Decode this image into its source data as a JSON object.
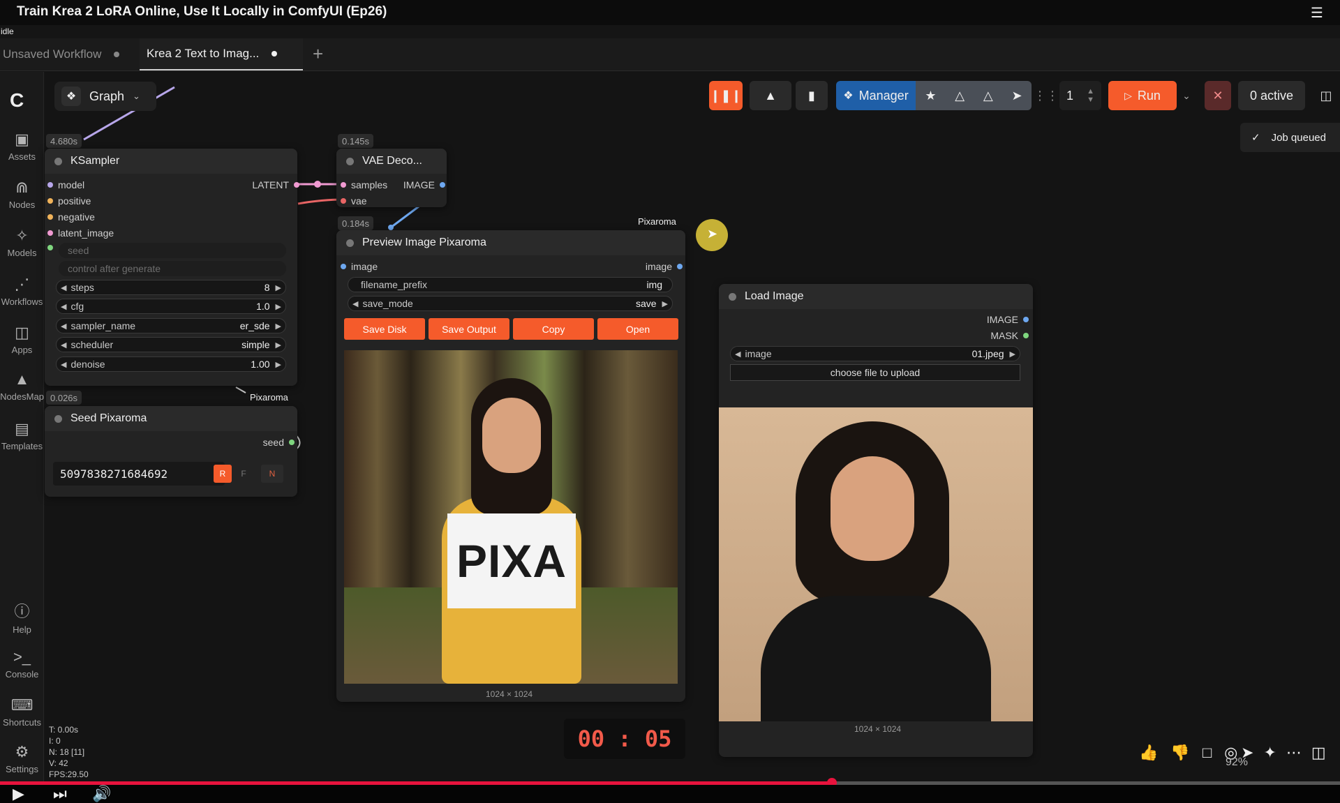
{
  "video": {
    "title": "Train Krea 2 LoRA Online, Use It Locally in ComfyUI (Ep26)"
  },
  "status": {
    "idle": "idle"
  },
  "tabs": [
    {
      "label": "Unsaved Workflow"
    },
    {
      "label": "Krea 2 Text to Imag..."
    }
  ],
  "sidebar": {
    "items": [
      {
        "label": "Assets",
        "icon": "image-icon"
      },
      {
        "label": "Nodes",
        "icon": "nodes-icon"
      },
      {
        "label": "Models",
        "icon": "models-icon"
      },
      {
        "label": "Workflows",
        "icon": "workflows-icon"
      },
      {
        "label": "Apps",
        "icon": "apps-icon"
      },
      {
        "label": "NodesMap",
        "icon": "nodesmap-icon"
      },
      {
        "label": "Templates",
        "icon": "templates-icon"
      },
      {
        "label": "Help",
        "icon": "help-icon"
      },
      {
        "label": "Console",
        "icon": "console-icon"
      },
      {
        "label": "Shortcuts",
        "icon": "keyboard-icon"
      },
      {
        "label": "Settings",
        "icon": "gear-icon"
      }
    ]
  },
  "graph_toggle": {
    "label": "Graph"
  },
  "toolbar": {
    "manager_label": "Manager",
    "queue_count": "1",
    "run_label": "Run",
    "active_label": "0 active"
  },
  "toast": {
    "text": "Job queued"
  },
  "stats": [
    "T: 0.00s",
    "I: 0",
    "N: 18 [11]",
    "V: 42",
    "FPS:29.50"
  ],
  "nodes": {
    "ksampler": {
      "title": "KSampler",
      "timing": "4.680s",
      "inputs": [
        "model",
        "positive",
        "negative",
        "latent_image"
      ],
      "output": "LATENT",
      "seed_label": "seed",
      "control_label": "control after generate",
      "widgets": [
        {
          "name": "steps",
          "value": "8"
        },
        {
          "name": "cfg",
          "value": "1.0"
        },
        {
          "name": "sampler_name",
          "value": "er_sde"
        },
        {
          "name": "scheduler",
          "value": "simple"
        },
        {
          "name": "denoise",
          "value": "1.00"
        }
      ]
    },
    "vae_decode": {
      "title": "VAE Deco...",
      "timing": "0.145s",
      "inputs": [
        "samples",
        "vae"
      ],
      "output": "IMAGE"
    },
    "preview": {
      "title": "Preview Image Pixaroma",
      "timing": "0.184s",
      "group_label": "Pixaroma",
      "input": "image",
      "output": "image",
      "widgets": [
        {
          "name": "filename_prefix",
          "value": "img"
        },
        {
          "name": "save_mode",
          "value": "save"
        }
      ],
      "buttons": [
        "Save Disk",
        "Save Output",
        "Copy",
        "Open"
      ],
      "image_text": "PIXA",
      "size": "1024 × 1024"
    },
    "seed": {
      "title": "Seed Pixaroma",
      "timing": "0.026s",
      "group_label": "Pixaroma",
      "output": "seed",
      "value": "5097838271684692",
      "buttons": [
        "R",
        "F",
        "N"
      ]
    },
    "load_image": {
      "title": "Load Image",
      "outputs": [
        "IMAGE",
        "MASK"
      ],
      "widget": {
        "name": "image",
        "value": "01.jpeg"
      },
      "upload_label": "choose file to upload",
      "size": "1024 × 1024"
    }
  },
  "timer": {
    "text": "00 : 05"
  },
  "zoom": {
    "text": "92%"
  },
  "colors": {
    "accent": "#f55b2b",
    "manager": "#1f5fa8",
    "cursor_highlight": "#d9c23a",
    "progress": "#e8133d"
  }
}
